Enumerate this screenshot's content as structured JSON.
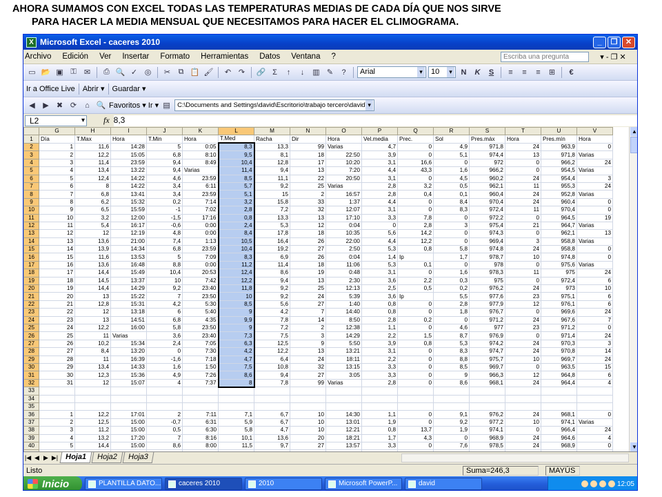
{
  "caption": {
    "line1": "AHORA SUMAMOS CON EXCEL TODAS LAS TEMPERATURAS MEDIAS DE CADA DÍA QUE NOS SIRVE",
    "line2": "PARA HACER LA MEDIA MENSUAL QUE NECESITAMOS PARA HACER EL CLIMOGRAMA."
  },
  "window": {
    "title": "Microsoft Excel - caceres 2010",
    "controls": [
      "_",
      "❐",
      "✕"
    ]
  },
  "menu": {
    "items": [
      "Archivo",
      "Edición",
      "Ver",
      "Insertar",
      "Formato",
      "Herramientas",
      "Datos",
      "Ventana",
      "?"
    ],
    "ask_placeholder": "Escriba una pregunta",
    "doc_controls": "▾ - ❐ ✕"
  },
  "toolbar1": {
    "font_name": "Arial",
    "font_size": "10",
    "bold": "N",
    "italic": "K",
    "underline": "S",
    "currency": "€"
  },
  "toolbar2": {
    "office_live": "Ir a Office Live",
    "open": "Abrir ▾",
    "save": "Guardar ▾"
  },
  "toolbar3": {
    "favorites": "Favoritos ▾",
    "go": "Ir ▾",
    "path": "C:\\Documents and Settings\\david\\Escritorio\\trabajo tercero\\david\\"
  },
  "formula": {
    "namebox": "L2",
    "fx": "fx",
    "value": "8,3"
  },
  "columns": [
    "",
    "G",
    "H",
    "I",
    "J",
    "K",
    "L",
    "M",
    "N",
    "O",
    "P",
    "Q",
    "R",
    "S",
    "T",
    "U",
    "V"
  ],
  "rows": [
    {
      "n": "1",
      "c": [
        "Día",
        "T.Max",
        "Hora",
        "T.Min",
        "Hora",
        "T.Med",
        "Racha",
        "Dir",
        "Hora",
        "Vel.media",
        "Prec.",
        "Sol",
        "Pres.máx",
        "Hora",
        "Pres.mín",
        "Hora"
      ]
    },
    {
      "n": "2",
      "c": [
        "1",
        "11,6",
        "14:28",
        "5",
        "0:05",
        "8,3",
        "13,3",
        "99",
        "Varias",
        "4,7",
        "0",
        "4,9",
        "971,8",
        "24",
        "963,9",
        "0"
      ]
    },
    {
      "n": "3",
      "c": [
        "2",
        "12,2",
        "15:05",
        "6,8",
        "8:10",
        "9,5",
        "8,1",
        "18",
        "22:50",
        "3,9",
        "0",
        "5,1",
        "974,4",
        "13",
        "971,8",
        "Varias"
      ]
    },
    {
      "n": "4",
      "c": [
        "3",
        "11,4",
        "23:59",
        "9,4",
        "8:49",
        "10,4",
        "12,8",
        "17",
        "10:20",
        "3,1",
        "16,6",
        "0",
        "972",
        "0",
        "966,2",
        "24"
      ]
    },
    {
      "n": "5",
      "c": [
        "4",
        "13,4",
        "13:22",
        "9,4",
        "Varias",
        "11,4",
        "9,4",
        "13",
        "7:20",
        "4,4",
        "43,3",
        "1,6",
        "966,2",
        "0",
        "954,5",
        "Varias"
      ]
    },
    {
      "n": "6",
      "c": [
        "5",
        "12,4",
        "14:22",
        "4,6",
        "23:59",
        "8,5",
        "11,1",
        "22",
        "20:50",
        "3,1",
        "0",
        "4,5",
        "960,2",
        "24",
        "954,4",
        "3"
      ]
    },
    {
      "n": "7",
      "c": [
        "6",
        "8",
        "14:22",
        "3,4",
        "6:11",
        "5,7",
        "9,2",
        "25",
        "Varias",
        "2,8",
        "3,2",
        "0,5",
        "962,1",
        "11",
        "955,3",
        "24"
      ]
    },
    {
      "n": "8",
      "c": [
        "7",
        "6,8",
        "13:41",
        "3,4",
        "23:59",
        "5,1",
        "15",
        "2",
        "16:57",
        "2,8",
        "0,4",
        "0,1",
        "960,4",
        "24",
        "952,8",
        "Varias"
      ]
    },
    {
      "n": "9",
      "c": [
        "8",
        "6,2",
        "15:32",
        "0,2",
        "7:14",
        "3,2",
        "15,8",
        "33",
        "1:37",
        "4,4",
        "0",
        "8,4",
        "970,4",
        "24",
        "960,4",
        "0"
      ]
    },
    {
      "n": "10",
      "c": [
        "9",
        "6,5",
        "15:59",
        "-1",
        "7:02",
        "2,8",
        "7,2",
        "32",
        "12:07",
        "3,1",
        "0",
        "8,3",
        "972,4",
        "11",
        "970,4",
        "0"
      ]
    },
    {
      "n": "11",
      "c": [
        "10",
        "3,2",
        "12:00",
        "-1,5",
        "17:16",
        "0,8",
        "13,3",
        "13",
        "17:10",
        "3,3",
        "7,8",
        "0",
        "972,2",
        "0",
        "964,5",
        "19"
      ]
    },
    {
      "n": "12",
      "c": [
        "11",
        "5,4",
        "16:17",
        "-0,6",
        "0:00",
        "2,4",
        "5,3",
        "12",
        "0:04",
        "0",
        "2,8",
        "3",
        "975,4",
        "21",
        "964,7",
        "Varias"
      ]
    },
    {
      "n": "13",
      "c": [
        "12",
        "12",
        "12:19",
        "4,8",
        "0:00",
        "8,4",
        "17,8",
        "18",
        "10:35",
        "5,6",
        "14,2",
        "0",
        "974,3",
        "0",
        "962,1",
        "13"
      ]
    },
    {
      "n": "14",
      "c": [
        "13",
        "13,6",
        "21:00",
        "7,4",
        "1:13",
        "10,5",
        "16,4",
        "26",
        "22:00",
        "4,4",
        "12,2",
        "0",
        "969,4",
        "3",
        "958,8",
        "Varias"
      ]
    },
    {
      "n": "15",
      "c": [
        "14",
        "13,9",
        "14:34",
        "6,8",
        "23:59",
        "10,4",
        "19,2",
        "27",
        "2:50",
        "5,3",
        "0,8",
        "5,8",
        "974,8",
        "24",
        "958,8",
        "0"
      ]
    },
    {
      "n": "16",
      "c": [
        "15",
        "11,6",
        "13:53",
        "5",
        "7:09",
        "8,3",
        "6,9",
        "26",
        "0:04",
        "1,4",
        "Ip",
        "1,7",
        "978,7",
        "10",
        "974,8",
        "0"
      ]
    },
    {
      "n": "17",
      "c": [
        "16",
        "13,6",
        "16:48",
        "8,8",
        "0:00",
        "11,2",
        "11,4",
        "18",
        "11:06",
        "5,3",
        "0,1",
        "0",
        "978",
        "0",
        "975,6",
        "Varias"
      ]
    },
    {
      "n": "18",
      "c": [
        "17",
        "14,4",
        "15:49",
        "10,4",
        "20:53",
        "12,4",
        "8,6",
        "19",
        "0:48",
        "3,1",
        "0",
        "1,6",
        "978,3",
        "11",
        "975",
        "24"
      ]
    },
    {
      "n": "19",
      "c": [
        "18",
        "14,5",
        "13:37",
        "10",
        "7:42",
        "12,2",
        "9,4",
        "13",
        "2:30",
        "3,6",
        "2,2",
        "0,3",
        "975",
        "0",
        "972,4",
        "6"
      ]
    },
    {
      "n": "20",
      "c": [
        "19",
        "14,4",
        "14:29",
        "9,2",
        "23:40",
        "11,8",
        "9,2",
        "25",
        "12:13",
        "2,5",
        "0,5",
        "0,2",
        "976,2",
        "24",
        "973",
        "10"
      ]
    },
    {
      "n": "21",
      "c": [
        "20",
        "13",
        "15:22",
        "7",
        "23:50",
        "10",
        "9,2",
        "24",
        "5:39",
        "3,6",
        "Ip",
        "5,5",
        "977,6",
        "23",
        "975,1",
        "6"
      ]
    },
    {
      "n": "22",
      "c": [
        "21",
        "12,8",
        "15:31",
        "4,2",
        "5:30",
        "8,5",
        "5,6",
        "27",
        "1:40",
        "0,8",
        "0",
        "2,8",
        "977,9",
        "12",
        "976,1",
        "6"
      ]
    },
    {
      "n": "23",
      "c": [
        "22",
        "12",
        "13:18",
        "6",
        "5:40",
        "9",
        "4,2",
        "7",
        "14:40",
        "0,8",
        "0",
        "1,8",
        "976,7",
        "0",
        "969,6",
        "24"
      ]
    },
    {
      "n": "24",
      "c": [
        "23",
        "13",
        "14:51",
        "6,8",
        "4:35",
        "9,9",
        "7,8",
        "14",
        "8:50",
        "2,8",
        "0,2",
        "0",
        "971,2",
        "24",
        "967,6",
        "7"
      ]
    },
    {
      "n": "25",
      "c": [
        "24",
        "12,2",
        "16:00",
        "5,8",
        "23:50",
        "9",
        "7,2",
        "2",
        "12:38",
        "1,1",
        "0",
        "4,6",
        "977",
        "23",
        "971,2",
        "0"
      ]
    },
    {
      "n": "26",
      "c": [
        "25",
        "11",
        "Varias",
        "3,6",
        "23:40",
        "7,3",
        "7,5",
        "3",
        "14:29",
        "2,2",
        "1,5",
        "8,7",
        "976,9",
        "0",
        "971,4",
        "24"
      ]
    },
    {
      "n": "27",
      "c": [
        "26",
        "10,2",
        "15:34",
        "2,4",
        "7:05",
        "6,3",
        "12,5",
        "9",
        "5:50",
        "3,9",
        "0,8",
        "5,3",
        "974,2",
        "24",
        "970,3",
        "3"
      ]
    },
    {
      "n": "28",
      "c": [
        "27",
        "8,4",
        "13:20",
        "0",
        "7:30",
        "4,2",
        "12,2",
        "13",
        "13:21",
        "3,1",
        "0",
        "8,3",
        "974,7",
        "24",
        "970,8",
        "14"
      ]
    },
    {
      "n": "29",
      "c": [
        "28",
        "11",
        "16:39",
        "-1,6",
        "7:18",
        "4,7",
        "6,4",
        "24",
        "18:11",
        "2,2",
        "0",
        "8,8",
        "975,7",
        "10",
        "969,7",
        "24"
      ]
    },
    {
      "n": "30",
      "c": [
        "29",
        "13,4",
        "14:33",
        "1,6",
        "1:50",
        "7,5",
        "10,8",
        "32",
        "13:15",
        "3,3",
        "0",
        "8,5",
        "969,7",
        "0",
        "963,5",
        "15"
      ]
    },
    {
      "n": "31",
      "c": [
        "30",
        "12,3",
        "15:36",
        "4,9",
        "7:26",
        "8,6",
        "9,4",
        "27",
        "3:05",
        "3,3",
        "0",
        "9",
        "966,3",
        "12",
        "964,8",
        "6"
      ]
    },
    {
      "n": "32",
      "c": [
        "31",
        "12",
        "15:07",
        "4",
        "7:37",
        "8",
        "7,8",
        "99",
        "Varias",
        "2,8",
        "0",
        "8,6",
        "968,1",
        "24",
        "964,4",
        "4"
      ]
    },
    {
      "n": "33",
      "c": [
        "",
        "",
        "",
        "",
        "",
        "",
        "",
        "",
        "",
        "",
        "",
        "",
        "",
        "",
        "",
        ""
      ]
    },
    {
      "n": "34",
      "c": [
        "",
        "",
        "",
        "",
        "",
        "",
        "",
        "",
        "",
        "",
        "",
        "",
        "",
        "",
        "",
        ""
      ]
    },
    {
      "n": "35",
      "c": [
        "",
        "",
        "",
        "",
        "",
        "",
        "",
        "",
        "",
        "",
        "",
        "",
        "",
        "",
        "",
        ""
      ]
    },
    {
      "n": "36",
      "c": [
        "1",
        "12,2",
        "17:01",
        "2",
        "7:11",
        "7,1",
        "6,7",
        "10",
        "14:30",
        "1,1",
        "0",
        "9,1",
        "976,2",
        "24",
        "968,1",
        "0"
      ]
    },
    {
      "n": "37",
      "c": [
        "2",
        "12,5",
        "15:00",
        "-0,7",
        "6:31",
        "5,9",
        "6,7",
        "10",
        "13:01",
        "1,9",
        "0",
        "9,2",
        "977,2",
        "10",
        "974,1",
        "Varias"
      ]
    },
    {
      "n": "38",
      "c": [
        "3",
        "11,2",
        "15:00",
        "0,5",
        "6:30",
        "5,8",
        "4,7",
        "10",
        "12:21",
        "0,8",
        "13,7",
        "1,9",
        "974,1",
        "0",
        "966,4",
        "24"
      ]
    },
    {
      "n": "39",
      "c": [
        "4",
        "13,2",
        "17:20",
        "7",
        "8:16",
        "10,1",
        "13,6",
        "20",
        "18:21",
        "1,7",
        "4,3",
        "0",
        "968,9",
        "24",
        "964,6",
        "4"
      ]
    },
    {
      "n": "40",
      "c": [
        "5",
        "14,4",
        "15:00",
        "8,6",
        "8:00",
        "11,5",
        "9,7",
        "27",
        "13:57",
        "3,3",
        "0",
        "7,6",
        "978,5",
        "24",
        "968,9",
        "0"
      ]
    },
    {
      "n": "41",
      "c": [
        "6",
        "13,6",
        "12:43",
        "6,8",
        "8:12",
        "10,2",
        "6,9",
        "32",
        "11:44",
        "3,1",
        "0",
        "8,9",
        "978,6",
        "11",
        "973,4",
        "24"
      ]
    },
    {
      "n": "42",
      "c": [
        "7",
        "13,4",
        "15:55",
        "4,9",
        "6:30",
        "9,2",
        "7,2",
        "18",
        "18:50",
        "0,6",
        "2,2",
        "0,9",
        "973,4",
        "0",
        "964,3",
        "24"
      ]
    }
  ],
  "tabs": [
    "Hoja1",
    "Hoja2",
    "Hoja3"
  ],
  "status": {
    "ready": "Listo",
    "sum": "Suma=246,3",
    "caps": "MAYÚS"
  },
  "taskbar": {
    "start": "Inicio",
    "tasks": [
      "PLANTILLA DATO...",
      "caceres 2010",
      "2010",
      "Microsoft PowerP...",
      "david"
    ],
    "clock": "12:05"
  }
}
